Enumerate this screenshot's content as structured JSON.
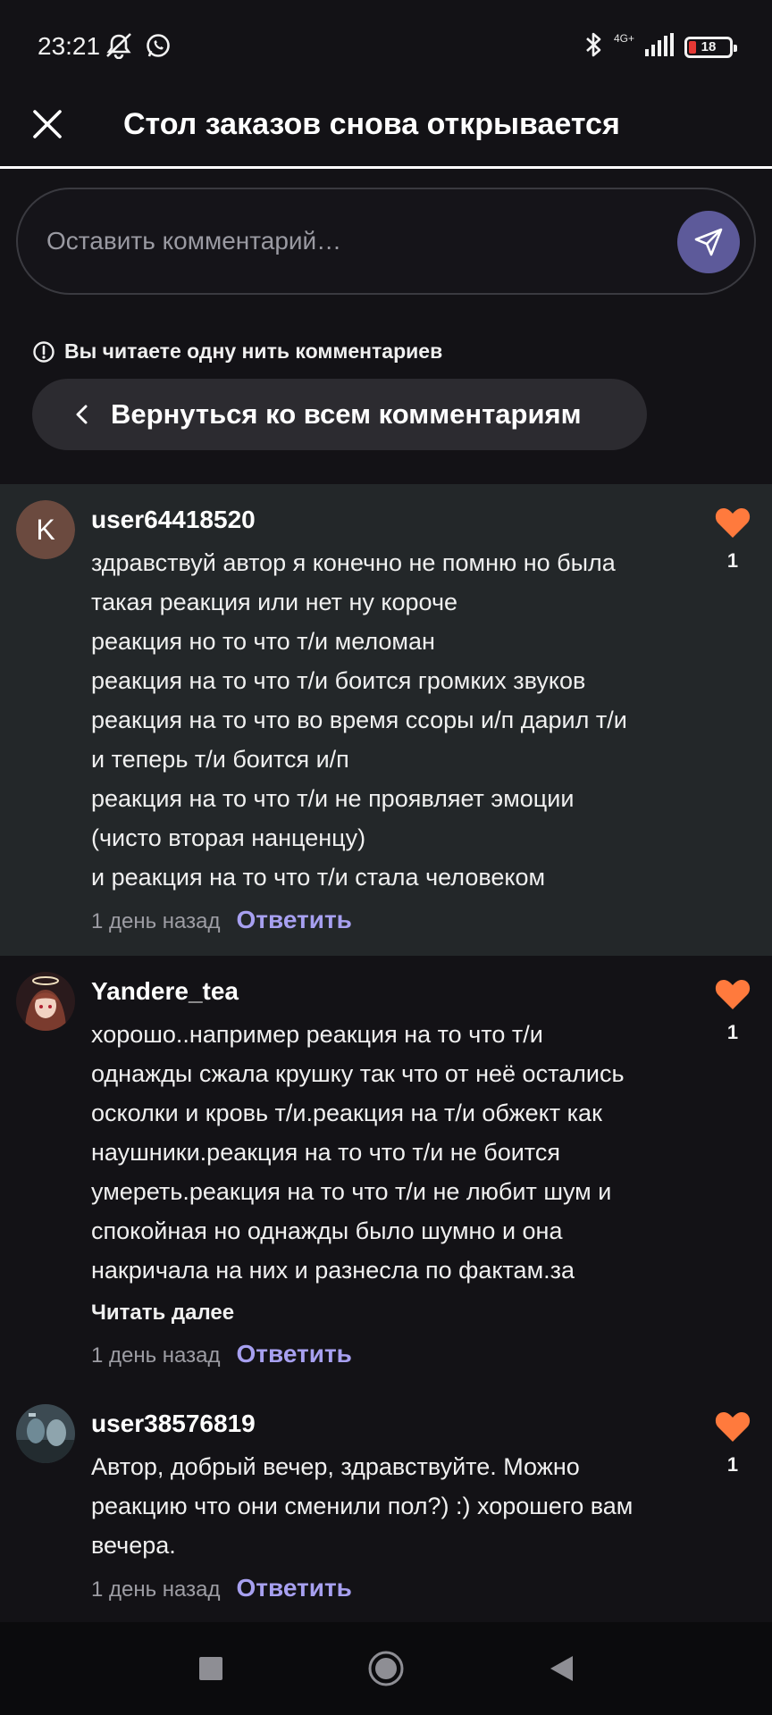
{
  "status_bar": {
    "time": "23:21",
    "network": "4G+",
    "battery": "18",
    "battery_level": 0.18,
    "icons": [
      "mute-icon",
      "whatsapp-icon",
      "bluetooth-icon",
      "signal-icon",
      "battery-icon"
    ]
  },
  "header": {
    "title": "Стол заказов снова открывается",
    "close_icon": "close-icon"
  },
  "comment_input": {
    "placeholder": "Оставить комментарий…",
    "send_icon": "send-icon",
    "send_button_color": "#5d5a9a"
  },
  "thread": {
    "notice": "Вы читаете одну нить комментариев",
    "back_label": "Вернуться ко всем комментариям"
  },
  "comments": [
    {
      "avatar_letter": "K",
      "username": "user64418520",
      "lines": [
        "здравствуй автор я конечно не помню но была",
        "такая реакция или нет ну короче",
        "реакция но то что т/и меломан",
        "реакция на то что т/и боится громких звуков",
        "реакция на то что во время ссоры и/п дарил т/и",
        "и теперь т/и боится и/п",
        "реакция на то что т/и не проявляет эмоции",
        "(чисто вторая нанценцу)",
        "и реакция на то что т/и стала человеком"
      ],
      "time": "1 день назад",
      "reply": "Ответить",
      "likes": "1"
    },
    {
      "username": "Yandere_tea",
      "lines": [
        "хорошо..например реакция на то что т/и",
        "однажды сжала крушку так что от неё остались",
        "осколки и кровь т/и.реакция на т/и обжект как",
        "наушники.реакция на то что т/и не боится",
        "умереть.реакция на то что т/и не любит шум и",
        "спокойная но однажды было шумно и она",
        "накричала на них и разнесла по фактам.за"
      ],
      "read_more": "Читать далее",
      "time": "1 день назад",
      "reply": "Ответить",
      "likes": "1"
    },
    {
      "username": "user38576819",
      "lines": [
        "Автор, добрый вечер, здравствуйте. Можно",
        "реакцию что они сменили пол?) :) хорошего вам",
        "вечера."
      ],
      "time": "1 день назад",
      "reply": "Ответить",
      "likes": "1"
    }
  ],
  "colors": {
    "background": "#131216",
    "highlight_comment": "#232729",
    "reply_link": "#a7a0f0",
    "heart": "#ff7a3d"
  },
  "nav": {
    "icons": [
      "recent-apps-icon",
      "home-icon",
      "back-icon"
    ]
  }
}
